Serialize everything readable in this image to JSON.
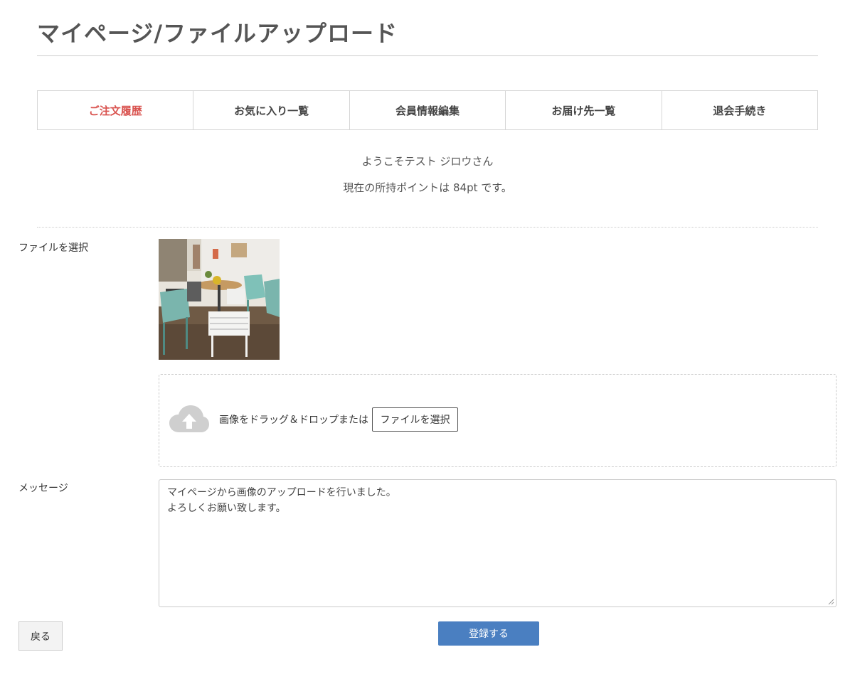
{
  "page": {
    "title": "マイページ/ファイルアップロード"
  },
  "tabs": [
    {
      "label": "ご注文履歴",
      "active": true
    },
    {
      "label": "お気に入り一覧"
    },
    {
      "label": "会員情報編集"
    },
    {
      "label": "お届け先一覧"
    },
    {
      "label": "退会手続き"
    }
  ],
  "welcome": {
    "greeting": "ようこそテスト ジロウさん",
    "points": "現在の所持ポイントは 84pt です。"
  },
  "form": {
    "file_label": "ファイルを選択",
    "dropzone_text": "画像をドラッグ＆ドロップまたは",
    "file_button": "ファイルを選択",
    "upload_icon": "cloud-upload-icon",
    "message_label": "メッセージ",
    "message_value": "マイページから画像のアップロードを行いました。\nよろしくお願い致します。"
  },
  "actions": {
    "back": "戻る",
    "submit": "登録する"
  },
  "colors": {
    "active_tab": "#d9534f",
    "primary": "#4a7fc1"
  }
}
